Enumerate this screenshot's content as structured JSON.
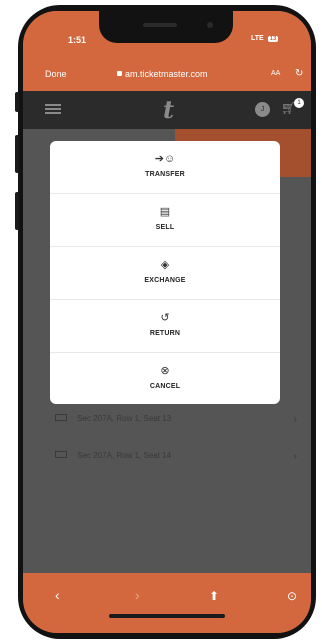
{
  "status": {
    "time": "1:51",
    "network": "LTE",
    "battery": "13"
  },
  "browser": {
    "done_label": "Done",
    "url": "am.ticketmaster.com",
    "aa_label": "AA"
  },
  "header": {
    "logo": "t",
    "avatar_initial": "J",
    "cart_count": "1"
  },
  "modal": {
    "options": [
      {
        "label": "TRANSFER",
        "icon": "transfer-icon"
      },
      {
        "label": "SELL",
        "icon": "sell-icon"
      },
      {
        "label": "EXCHANGE",
        "icon": "exchange-icon"
      },
      {
        "label": "RETURN",
        "icon": "return-icon"
      },
      {
        "label": "CANCEL",
        "icon": "cancel-icon"
      }
    ]
  },
  "tickets": [
    {
      "label": "Sec 207A, Row 1, Seat 13"
    },
    {
      "label": "Sec 207A, Row 1, Seat 14"
    }
  ],
  "colors": {
    "accent": "#d3683f",
    "overlay": "#555555",
    "header": "#2b2b2b"
  }
}
